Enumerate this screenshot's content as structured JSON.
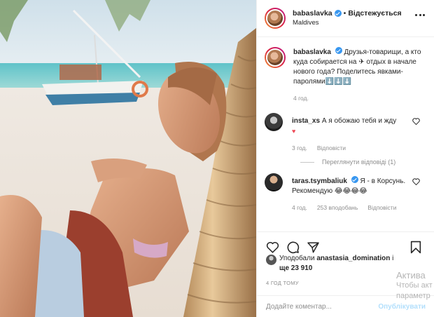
{
  "post": {
    "username": "babaslavka",
    "follow_label": "Відстежується",
    "separator": "•",
    "location": "Maldives",
    "caption": "Друзья-товарищи, а кто куда собирается на ✈ отдых в начале нового года? Поделитесь явками-паролями⬇️⬇️⬇️",
    "caption_time": "4 год."
  },
  "comments": [
    {
      "username": "insta_xs",
      "text": "А я обожаю тебя и жду",
      "emoji": "♥",
      "time": "3 год.",
      "reply_label": "Відповісти",
      "view_replies": "Переглянути відповіді (1)"
    },
    {
      "username": "taras.tsymbaliuk",
      "text": "Я - в Корсунь. Рекомендую 😂😂😂😂",
      "time": "4 год.",
      "likes": "253 вподобань",
      "reply_label": "Відповісти"
    }
  ],
  "likes": {
    "prefix": "Уподобали",
    "user": "anastasia_domination",
    "suffix": "і",
    "more": "ще 23 910"
  },
  "time_ago": "4 ГОД ТОМУ",
  "comment_box": {
    "placeholder": "Додайте коментар...",
    "publish_label": "Опублікувати"
  },
  "watermark": {
    "line1": "Актива",
    "line2": "Чтобы акт",
    "line3": "параметр"
  },
  "icons": {
    "like": "heart-icon",
    "comment": "comment-icon",
    "share": "share-icon",
    "save": "bookmark-icon",
    "more": "more-icon"
  },
  "colors": {
    "verified": "#3897f0",
    "heart": "#ed4956",
    "publish": "#b2dffc",
    "muted": "#8e8e8e"
  }
}
